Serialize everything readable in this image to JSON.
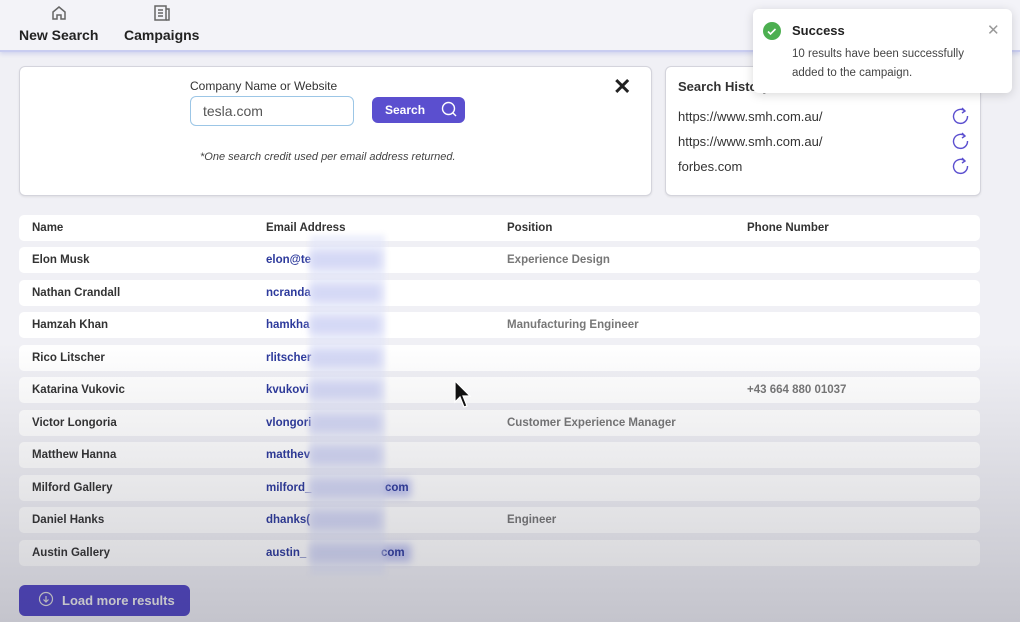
{
  "nav": {
    "items": [
      {
        "label": "New Search",
        "icon": "home-icon"
      },
      {
        "label": "Campaigns",
        "icon": "campaigns-icon"
      }
    ]
  },
  "search": {
    "label": "Company Name or Website",
    "value": "tesla.com",
    "button": "Search",
    "note": "*One search credit used per email address returned."
  },
  "history": {
    "title": "Search History",
    "items": [
      "https://www.smh.com.au/",
      "https://www.smh.com.au/",
      "forbes.com"
    ]
  },
  "table": {
    "headers": [
      "Name",
      "Email Address",
      "Position",
      "Phone Number"
    ],
    "rows": [
      {
        "name": "Elon Musk",
        "email": "elon@te",
        "email_end": "",
        "position": "Experience Design",
        "phone": ""
      },
      {
        "name": "Nathan Crandall",
        "email": "ncranda",
        "email_end": "",
        "position": "",
        "phone": ""
      },
      {
        "name": "Hamzah Khan",
        "email": "hamkha",
        "email_end": "",
        "position": "Manufacturing Engineer",
        "phone": ""
      },
      {
        "name": "Rico Litscher",
        "email": "rlitscher",
        "email_end": "",
        "position": "",
        "phone": ""
      },
      {
        "name": "Katarina Vukovic",
        "email": "kvukovi",
        "email_end": "",
        "position": "",
        "phone": "+43 664 880 01037"
      },
      {
        "name": "Victor Longoria",
        "email": "vlongori",
        "email_end": "",
        "position": "Customer Experience Manager",
        "phone": ""
      },
      {
        "name": "Matthew Hanna",
        "email": "matthev",
        "email_end": "",
        "position": "",
        "phone": ""
      },
      {
        "name": "Milford Gallery",
        "email": "milford_",
        "email_end": "com",
        "position": "",
        "phone": ""
      },
      {
        "name": "Daniel Hanks",
        "email": "dhanks(",
        "email_end": "",
        "position": "Engineer",
        "phone": ""
      },
      {
        "name": "Austin Gallery",
        "email": "austin_",
        "email_end": "com",
        "position": "",
        "phone": ""
      }
    ]
  },
  "load_more": "Load more results",
  "toast": {
    "title": "Success",
    "message": "10 results have been successfully added to the campaign."
  },
  "colors": {
    "accent": "#5b4fcf",
    "success": "#4caf50",
    "email": "#2d3a9c"
  }
}
